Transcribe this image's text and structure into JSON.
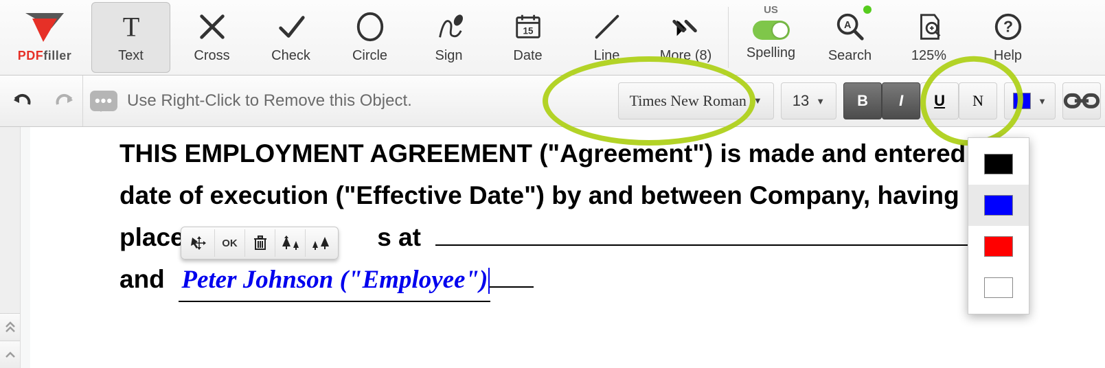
{
  "brand": {
    "prefix": "PDF",
    "suffix": "filler"
  },
  "toolbar": {
    "items": [
      {
        "label": "Text"
      },
      {
        "label": "Cross"
      },
      {
        "label": "Check"
      },
      {
        "label": "Circle"
      },
      {
        "label": "Sign"
      },
      {
        "label": "Date"
      },
      {
        "label": "Line"
      },
      {
        "label": "More (8)"
      }
    ],
    "right": {
      "spelling_lang": "US",
      "spelling": "Spelling",
      "search": "Search",
      "zoom": "125%",
      "help": "Help"
    }
  },
  "subbar": {
    "hint": "Use Right-Click to Remove this Object.",
    "font_family": "Times New Roman",
    "font_size": "13",
    "bold": "B",
    "italic": "I",
    "underline": "U",
    "normal": "N"
  },
  "mini": {
    "ok": "OK"
  },
  "doc": {
    "line1": "THIS EMPLOYMENT AGREEMENT (\"Agreement\") is made and entered",
    "line2": "date of execution (\"Effective Date\") by and between Company, having",
    "line3a": "place",
    "line3b": "s at",
    "line4a": "and",
    "employee": "Peter Johnson (\"Employee\")"
  },
  "colors": {
    "current": "#0000ff",
    "options": [
      "#000000",
      "#0000ff",
      "#ff0000",
      "#ffffff"
    ],
    "selected_index": 1
  }
}
